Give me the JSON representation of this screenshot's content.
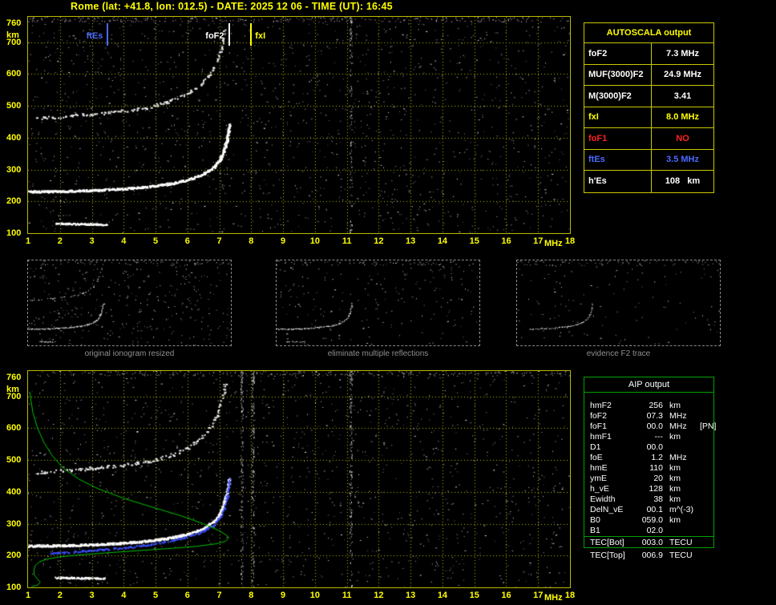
{
  "title": "Rome (lat: +41.8, lon: 012.5) - DATE: 2025 12 06 - TIME (UT): 16:45",
  "colors": {
    "background": "#000000",
    "axis_yellow": "#ffff00",
    "grid_yellow": "#bebe00",
    "trace_white": "#ffffff",
    "profile_green": "#00c400",
    "restored_blue": "#3c50ff",
    "foF1_red": "#ff2222",
    "ftEs_blue": "#4a6aff",
    "caption_gray": "#8f8f8f",
    "aip_border_green": "#00a000"
  },
  "autoscala_table": {
    "header": "AUTOSCALA output",
    "rows": [
      {
        "label": "foF2",
        "value": "7.3 MHz",
        "color": "#ffffff"
      },
      {
        "label": "MUF(3000)F2",
        "value": "24.9 MHz",
        "color": "#ffffff"
      },
      {
        "label": "M(3000)F2",
        "value": "3.41",
        "color": "#ffffff"
      },
      {
        "label": "fxI",
        "value": "8.0 MHz",
        "color": "#ffff00"
      },
      {
        "label": "foF1",
        "value": "NO",
        "color": "#ff2222"
      },
      {
        "label": "ftEs",
        "value": "3.5 MHz",
        "color": "#4a6aff"
      },
      {
        "label": "h'Es",
        "value": "108   km",
        "color": "#ffffff"
      }
    ]
  },
  "aip_table": {
    "header": "AIP output",
    "rows": [
      {
        "name": "hmF2",
        "value": "256",
        "unit": "km",
        "extra": ""
      },
      {
        "name": "foF2",
        "value": "07.3",
        "unit": "MHz",
        "extra": ""
      },
      {
        "name": "foF1",
        "value": "00.0",
        "unit": "MHz",
        "extra": "[PN]"
      },
      {
        "name": "hmF1",
        "value": "---",
        "unit": "km",
        "extra": ""
      },
      {
        "name": "D1",
        "value": "00.0",
        "unit": "",
        "extra": ""
      },
      {
        "name": "foE",
        "value": "1.2",
        "unit": "MHz",
        "extra": ""
      },
      {
        "name": "hmE",
        "value": "110",
        "unit": "km",
        "extra": ""
      },
      {
        "name": "ymE",
        "value": "20",
        "unit": "km",
        "extra": ""
      },
      {
        "name": "h_vE",
        "value": "128",
        "unit": "km",
        "extra": ""
      },
      {
        "name": "Ewidth",
        "value": "38",
        "unit": "km",
        "extra": ""
      },
      {
        "name": "DelN_vE",
        "value": "00.1",
        "unit": "m^(-3)",
        "extra": ""
      },
      {
        "name": "B0",
        "value": "059.0",
        "unit": "km",
        "extra": ""
      },
      {
        "name": "B1",
        "value": "02.0",
        "unit": "",
        "extra": ""
      },
      {
        "name": "TEC[Bot]",
        "value": "003.0",
        "unit": "TECU",
        "extra": ""
      },
      {
        "name": "TEC[Top]",
        "value": "006.9",
        "unit": "TECU",
        "extra": ""
      }
    ]
  },
  "thumbnails": [
    {
      "caption": "original ionogram resized",
      "series": [
        "Es trace",
        "F2 trace",
        "F2 second hop"
      ],
      "noise": 330,
      "trace_density": 0.55,
      "fmin": 1
    },
    {
      "caption": "eliminate multiple reflections",
      "series": [
        "Es trace",
        "F2 trace"
      ],
      "noise": 210,
      "trace_density": 0.5,
      "fmin": 1
    },
    {
      "caption": "evidence F2 trace",
      "series": [
        "F2 trace"
      ],
      "noise": 120,
      "trace_density": 0.32,
      "fmin": 2.6
    }
  ],
  "chart_data": [
    {
      "id": "autoscaled-ionogram",
      "type": "scatter",
      "xlabel": "MHz",
      "ylabel": "km",
      "xlim": [
        1,
        18
      ],
      "ylim": [
        100,
        780
      ],
      "x_ticks": [
        1,
        2,
        3,
        4,
        5,
        6,
        7,
        8,
        9,
        10,
        11,
        12,
        13,
        14,
        15,
        16,
        17,
        18
      ],
      "y_ticks": [
        760,
        700,
        600,
        500,
        400,
        300,
        200,
        100
      ],
      "grid": true,
      "rfi_freqs": [
        11.12
      ],
      "markers": [
        {
          "label": "ftEs",
          "freq": 3.5,
          "color": "#4a6aff",
          "side": "left"
        },
        {
          "label": "foF2",
          "freq": 7.3,
          "color": "#ffffff",
          "side": "left"
        },
        {
          "label": "fxI",
          "freq": 8.0,
          "color": "#ffff00",
          "side": "right"
        }
      ],
      "series": [
        {
          "name": "Es trace",
          "color": "#ffffff",
          "size": 2,
          "density": 1.3,
          "jitter": 2,
          "gap": 0.1,
          "points": [
            [
              1.85,
              132
            ],
            [
              3.45,
              129
            ]
          ]
        },
        {
          "name": "F2 trace",
          "color": "#ffffff",
          "size": 2,
          "density": 1.7,
          "jitter": 2.6,
          "gap": 0,
          "points": [
            [
              1.0,
              232
            ],
            [
              2.0,
              233
            ],
            [
              3.0,
              236
            ],
            [
              4.0,
              241
            ],
            [
              4.8,
              248
            ],
            [
              5.5,
              258
            ],
            [
              6.0,
              269
            ],
            [
              6.4,
              283
            ],
            [
              6.8,
              307
            ],
            [
              7.0,
              332
            ],
            [
              7.12,
              362
            ],
            [
              7.22,
              400
            ],
            [
              7.3,
              445
            ]
          ]
        },
        {
          "name": "F2 second hop",
          "color": "#e8e8e8",
          "size": 2,
          "density": 0.85,
          "jitter": 3.5,
          "gap": 0.45,
          "points": [
            [
              1.2,
              462
            ],
            [
              2.0,
              468
            ],
            [
              3.0,
              476
            ],
            [
              4.0,
              486
            ],
            [
              4.8,
              498
            ],
            [
              5.5,
              518
            ],
            [
              6.0,
              540
            ],
            [
              6.4,
              568
            ],
            [
              6.8,
              616
            ],
            [
              7.0,
              664
            ],
            [
              7.1,
              706
            ],
            [
              7.18,
              750
            ]
          ]
        }
      ]
    },
    {
      "id": "ionogram-with-restored-trace-and-profile",
      "type": "scatter",
      "xlabel": "MHz",
      "ylabel": "km",
      "xlim": [
        1,
        18
      ],
      "ylim": [
        100,
        780
      ],
      "x_ticks": [
        1,
        2,
        3,
        4,
        5,
        6,
        7,
        8,
        9,
        10,
        11,
        12,
        13,
        14,
        15,
        16,
        17,
        18
      ],
      "y_ticks": [
        760,
        700,
        600,
        500,
        400,
        300,
        200,
        100
      ],
      "grid": true,
      "rfi_freqs": [
        7.7,
        8.05,
        11.12
      ],
      "markers": [],
      "series": [
        {
          "name": "Es trace",
          "color": "#ffffff",
          "size": 2,
          "density": 1.3,
          "jitter": 2,
          "gap": 0.1,
          "points": [
            [
              1.85,
              132
            ],
            [
              3.4,
              130
            ]
          ]
        },
        {
          "name": "F2 trace",
          "color": "#ffffff",
          "size": 2,
          "density": 1.7,
          "jitter": 2.6,
          "gap": 0,
          "points": [
            [
              1.0,
              232
            ],
            [
              2.0,
              233
            ],
            [
              3.0,
              236
            ],
            [
              4.0,
              241
            ],
            [
              4.8,
              248
            ],
            [
              5.5,
              258
            ],
            [
              6.0,
              269
            ],
            [
              6.4,
              283
            ],
            [
              6.8,
              307
            ],
            [
              7.0,
              332
            ],
            [
              7.12,
              362
            ],
            [
              7.22,
              400
            ],
            [
              7.3,
              445
            ]
          ]
        },
        {
          "name": "F2 second hop",
          "color": "#e8e8e8",
          "size": 2,
          "density": 0.85,
          "jitter": 3.5,
          "gap": 0.45,
          "points": [
            [
              1.2,
              462
            ],
            [
              2.0,
              468
            ],
            [
              3.0,
              476
            ],
            [
              4.0,
              486
            ],
            [
              4.8,
              498
            ],
            [
              5.5,
              518
            ],
            [
              6.0,
              540
            ],
            [
              6.4,
              568
            ],
            [
              6.8,
              616
            ],
            [
              7.0,
              664
            ],
            [
              7.1,
              706
            ],
            [
              7.18,
              750
            ]
          ]
        },
        {
          "name": "restored trace",
          "color": "#3c50ff",
          "size": 2,
          "density": 0.8,
          "jitter": 2,
          "gap": 0.15,
          "points": [
            [
              1.7,
              208
            ],
            [
              2.4,
              213
            ],
            [
              3.2,
              219
            ],
            [
              4.0,
              226
            ],
            [
              4.7,
              235
            ],
            [
              5.4,
              246
            ],
            [
              5.9,
              258
            ],
            [
              6.4,
              274
            ],
            [
              6.8,
              296
            ],
            [
              7.05,
              326
            ],
            [
              7.18,
              366
            ],
            [
              7.27,
              412
            ],
            [
              7.32,
              448
            ]
          ]
        },
        {
          "name": "electron density profile",
          "color": "#00c400",
          "draw": "line",
          "width": 1,
          "points": [
            [
              1.05,
              715
            ],
            [
              1.15,
              650
            ],
            [
              1.3,
              600
            ],
            [
              1.5,
              555
            ],
            [
              1.75,
              515
            ],
            [
              2.1,
              475
            ],
            [
              2.6,
              440
            ],
            [
              3.2,
              410
            ],
            [
              4.0,
              380
            ],
            [
              4.9,
              352
            ],
            [
              5.8,
              325
            ],
            [
              6.5,
              300
            ],
            [
              7.0,
              278
            ],
            [
              7.25,
              262
            ],
            [
              7.3,
              256
            ],
            [
              7.2,
              245
            ],
            [
              6.9,
              237
            ],
            [
              6.3,
              229
            ],
            [
              5.4,
              222
            ],
            [
              4.4,
              215
            ],
            [
              3.4,
              208
            ],
            [
              2.6,
              202
            ],
            [
              2.0,
              196
            ],
            [
              1.6,
              189
            ],
            [
              1.35,
              180
            ],
            [
              1.22,
              168
            ],
            [
              1.18,
              152
            ],
            [
              1.2,
              138
            ],
            [
              1.3,
              126
            ],
            [
              1.38,
              116
            ],
            [
              1.3,
              107
            ],
            [
              1.1,
              102
            ]
          ]
        }
      ]
    }
  ]
}
